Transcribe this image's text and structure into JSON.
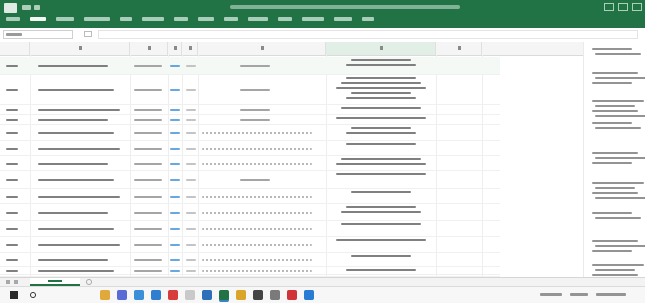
{
  "window": {
    "accent_color": "#217346"
  },
  "ribbon": {
    "tab_count": 14,
    "active_tab_index": 1
  },
  "formula_bar": {},
  "sheet": {
    "row_count": 15,
    "visible_columns": 7
  },
  "sheet_tabs": {
    "count": 1
  },
  "right_pane": {
    "block_count": 9
  },
  "taskbar": {
    "icons": [
      "file-explorer-icon",
      "chat-icon",
      "browser-icon",
      "edge-icon",
      "store-icon",
      "mail-icon",
      "photos-icon",
      "excel-icon",
      "chrome-icon",
      "terminal-icon",
      "settings-icon",
      "acrobat-icon",
      "vscode-icon"
    ]
  }
}
